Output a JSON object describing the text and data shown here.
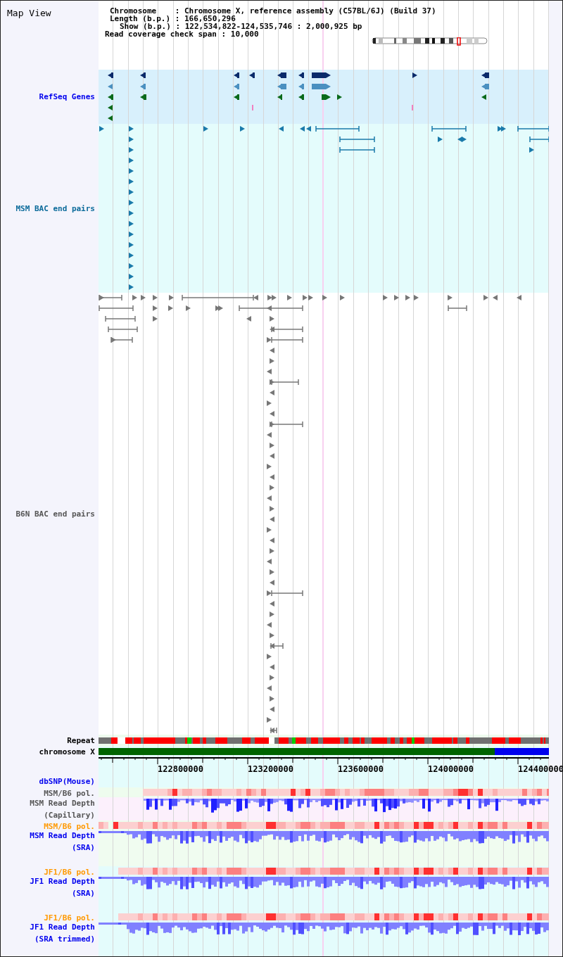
{
  "title": "Map View",
  "info_lines": [
    "Chromosome    : Chromosome X, reference assembly (C57BL/6J) (Build 37)",
    "Length (b.p.) : 166,650,296",
    "Show (b.p.) : 122,534,822-124,535,746 : 2,000,925 bp",
    "Read coverage check span : 10,000"
  ],
  "tracks": [
    {
      "label": "RefSeq Genes",
      "kind": "genes",
      "color": "#0000ee"
    },
    {
      "label": "MSM BAC end pairs",
      "kind": "msm_bac",
      "color": "#0a6a9a"
    },
    {
      "label": "B6N BAC end pairs",
      "kind": "b6n_bac",
      "color": "#555555"
    },
    {
      "label": "Repeat",
      "kind": "repeat",
      "color": "#000000"
    },
    {
      "label": "chromosome X",
      "kind": "chromosome",
      "color": "#000000"
    },
    {
      "kind": "ruler"
    },
    {
      "label": "dbSNP(Mouse)",
      "kind": "snp",
      "color": "#0000ee"
    },
    {
      "label": "MSM/B6 pol.",
      "kind": "pol_grey",
      "color": "#555555"
    },
    {
      "label": "MSM Read Depth\n(Capillary)",
      "kind": "depth_capillary",
      "color": "#555555"
    },
    {
      "label": "MSM/B6 pol.",
      "kind": "pol_msm",
      "color": "#ff9900"
    },
    {
      "label": "MSM Read Depth\n(SRA)",
      "kind": "depth_msm",
      "color": "#0000ee"
    },
    {
      "label": "JF1/B6 pol.",
      "kind": "pol_jf1",
      "color": "#ff9900"
    },
    {
      "label": "JF1 Read Depth\n(SRA)",
      "kind": "depth_jf1",
      "color": "#0000ee"
    },
    {
      "label": "JF1/B6 pol.",
      "kind": "pol_jf1",
      "color": "#ff9900"
    },
    {
      "label": "JF1 Read Depth\n(SRA trimmed)",
      "kind": "depth_jf1t",
      "color": "#0000ee"
    }
  ],
  "ruler_labels": [
    "122800000",
    "123200000",
    "123600000",
    "124000000",
    "124400000"
  ]
}
